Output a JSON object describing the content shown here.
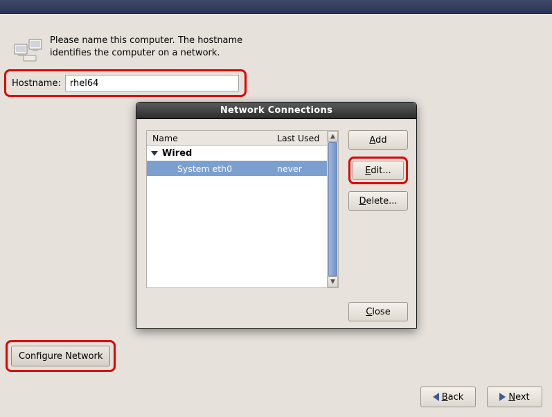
{
  "intro_text": "Please name this computer.  The hostname identifies the computer on a network.",
  "hostname": {
    "label": "Hostname:",
    "value": "rhel64"
  },
  "dialog": {
    "title": "Network Connections",
    "columns": {
      "name": "Name",
      "last_used": "Last Used"
    },
    "group": "Wired",
    "items": [
      {
        "name": "System eth0",
        "last_used": "never"
      }
    ],
    "buttons": {
      "add": "Add",
      "edit": "Edit...",
      "delete": "Delete...",
      "close": "Close"
    }
  },
  "buttons": {
    "configure_network": "Configure Network",
    "back": "Back",
    "next": "Next"
  }
}
